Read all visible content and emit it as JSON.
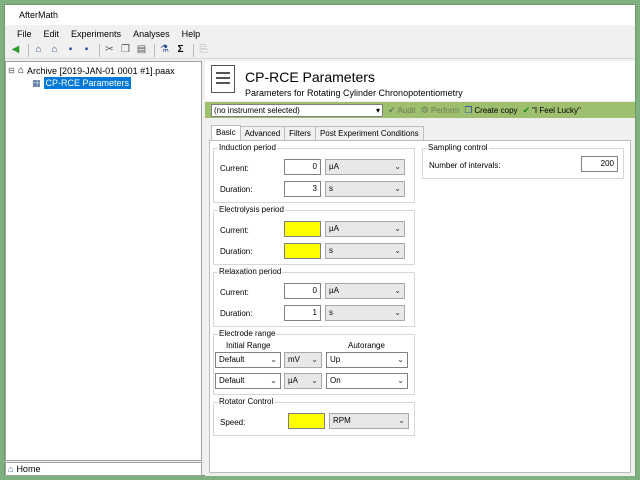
{
  "window": {
    "title": "AfterMath"
  },
  "menu": [
    "File",
    "Edit",
    "Experiments",
    "Analyses",
    "Help"
  ],
  "tree": {
    "archive_label": "Archive [2019-JAN-01 0001 #1].paax",
    "item_label": "CP-RCE Parameters"
  },
  "home_label": "Home",
  "header": {
    "title": "CP-RCE Parameters",
    "subtitle": "Parameters for Rotating Cylinder Chronopotentiometry"
  },
  "instrument": {
    "selected": "(no instrument selected)",
    "audit_label": "Audit",
    "perform_label": "Perform",
    "create_copy_label": "Create copy",
    "feel_lucky_label": "\"I Feel Lucky\""
  },
  "tabs": [
    "Basic",
    "Advanced",
    "Filters",
    "Post Experiment Conditions"
  ],
  "induction": {
    "title": "Induction period",
    "current_label": "Current:",
    "current_value": "0",
    "current_unit": "µA",
    "duration_label": "Duration:",
    "duration_value": "3",
    "duration_unit": "s"
  },
  "electrolysis": {
    "title": "Electrolysis period",
    "current_label": "Current:",
    "current_value": "",
    "current_unit": "µA",
    "duration_label": "Duration:",
    "duration_value": "",
    "duration_unit": "s"
  },
  "relaxation": {
    "title": "Relaxation period",
    "current_label": "Current:",
    "current_value": "0",
    "current_unit": "µA",
    "duration_label": "Duration:",
    "duration_value": "1",
    "duration_unit": "s"
  },
  "electrode_range": {
    "title": "Electrode range",
    "initial_range_label": "Initial Range",
    "autorange_label": "Autorange",
    "row1": {
      "range": "Default",
      "unit": "mV",
      "autorange": "Up"
    },
    "row2": {
      "range": "Default",
      "unit": "µA",
      "autorange": "On"
    }
  },
  "rotator": {
    "title": "Rotator Control",
    "speed_label": "Speed:",
    "speed_value": "",
    "speed_unit": "RPM"
  },
  "sampling": {
    "title": "Sampling control",
    "intervals_label": "Number of intervals:",
    "intervals_value": "200"
  },
  "colors": {
    "instrument_bar": "#9dbf6e",
    "selection": "#0078d7",
    "required_field": "#ffff00"
  }
}
